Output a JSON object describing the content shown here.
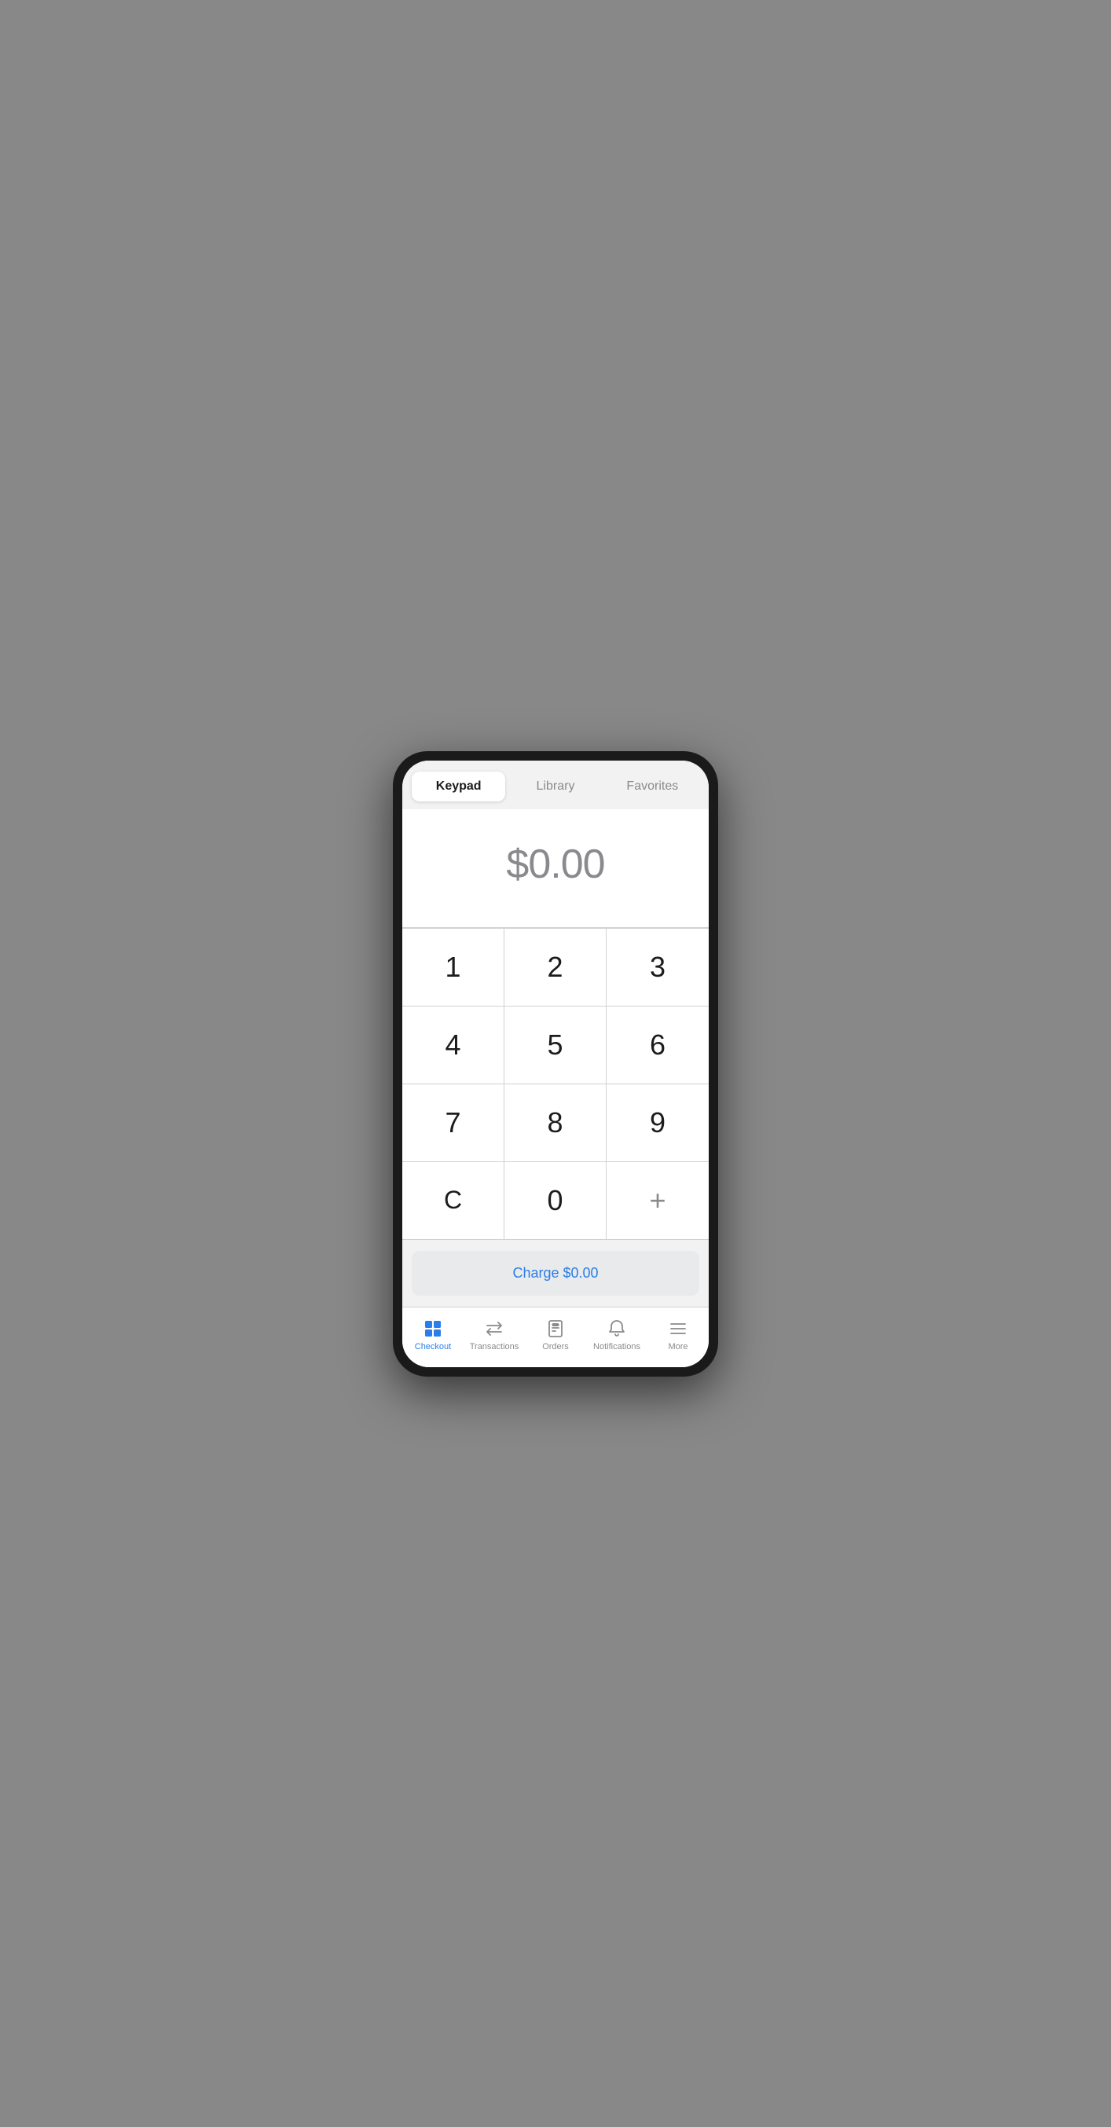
{
  "tabs": {
    "active": "Keypad",
    "items": [
      {
        "label": "Keypad",
        "active": true
      },
      {
        "label": "Library",
        "active": false
      },
      {
        "label": "Favorites",
        "active": false
      }
    ]
  },
  "amount": {
    "display": "$0.00"
  },
  "keypad": {
    "keys": [
      {
        "label": "1"
      },
      {
        "label": "2"
      },
      {
        "label": "3"
      },
      {
        "label": "4"
      },
      {
        "label": "5"
      },
      {
        "label": "6"
      },
      {
        "label": "7"
      },
      {
        "label": "8"
      },
      {
        "label": "9"
      },
      {
        "label": "C"
      },
      {
        "label": "0"
      },
      {
        "label": "+"
      }
    ]
  },
  "charge_button": {
    "label": "Charge $0.00"
  },
  "bottom_nav": {
    "items": [
      {
        "id": "checkout",
        "label": "Checkout",
        "active": true
      },
      {
        "id": "transactions",
        "label": "Transactions",
        "active": false
      },
      {
        "id": "orders",
        "label": "Orders",
        "active": false
      },
      {
        "id": "notifications",
        "label": "Notifications",
        "active": false
      },
      {
        "id": "more",
        "label": "More",
        "active": false
      }
    ]
  }
}
